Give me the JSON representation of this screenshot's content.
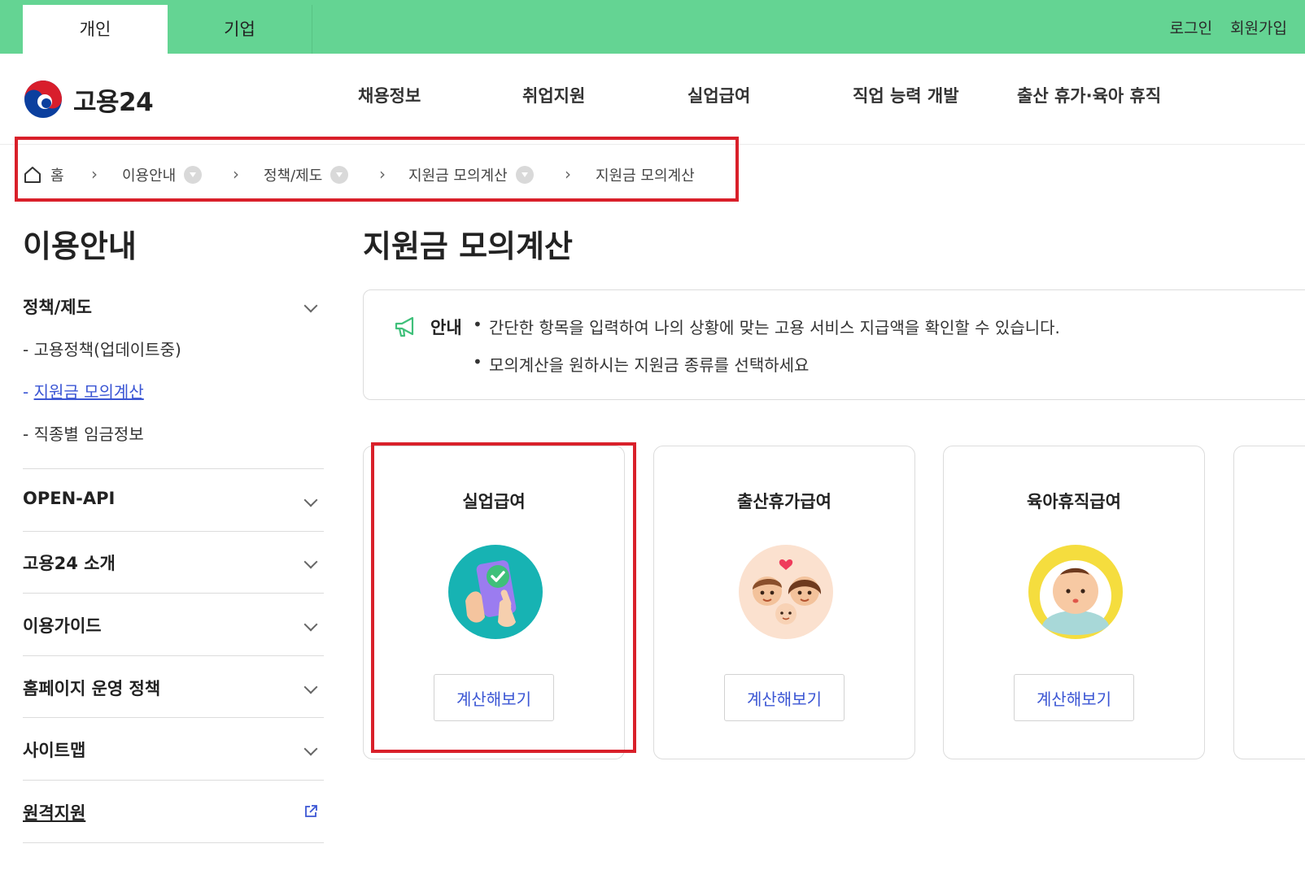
{
  "topbar": {
    "tabs": [
      {
        "label": "개인",
        "active": true
      },
      {
        "label": "기업",
        "active": false
      }
    ],
    "login": "로그인",
    "signup": "회원가입"
  },
  "header": {
    "logo_text": "고용24",
    "nav": [
      "채용정보",
      "취업지원",
      "실업급여",
      "직업 능력 개발",
      "출산 휴가·육아 휴직"
    ]
  },
  "breadcrumb": {
    "items": [
      "홈",
      "이용안내",
      "정책/제도",
      "지원금 모의계산",
      "지원금 모의계산"
    ]
  },
  "sidebar": {
    "title": "이용안내",
    "sections": [
      {
        "label": "정책/제도",
        "subitems": [
          {
            "label": "- 고용정책(업데이트중)",
            "active": false
          },
          {
            "label": "- ",
            "link": "지원금 모의계산",
            "active": true
          },
          {
            "label": "- 직종별 임금정보",
            "active": false
          }
        ]
      },
      {
        "label": "OPEN-API"
      },
      {
        "label": "고용24 소개"
      },
      {
        "label": "이용가이드"
      },
      {
        "label": "홈페이지 운영 정책"
      },
      {
        "label": "사이트맵"
      },
      {
        "label": "원격지원",
        "external": true
      }
    ]
  },
  "main": {
    "title": "지원금 모의계산",
    "notice": {
      "label": "안내",
      "lines": [
        "간단한 항목을 입력하여 나의 상황에 맞는 고용 서비스 지급액을 확인할 수 있습니다.",
        "모의계산을 원하시는 지원금 종류를 선택하세요"
      ]
    },
    "cards": [
      {
        "title": "실업급여",
        "icon": "phone-check-icon",
        "button": "계산해보기"
      },
      {
        "title": "출산휴가급여",
        "icon": "family-icon",
        "button": "계산해보기"
      },
      {
        "title": "육아휴직급여",
        "icon": "baby-icon",
        "button": "계산해보기"
      }
    ]
  },
  "colors": {
    "topbar_green": "#64d493",
    "link_blue": "#3b56d4",
    "highlight_red": "#d9202a"
  }
}
